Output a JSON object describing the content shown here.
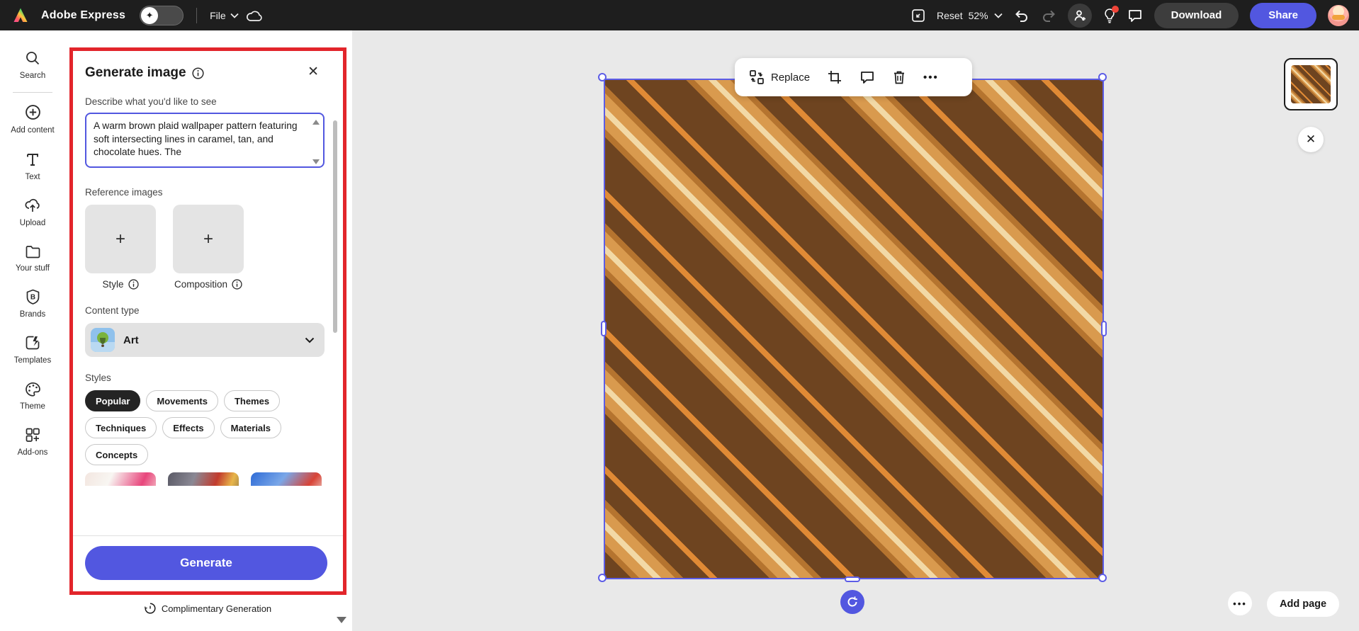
{
  "app": {
    "name": "Adobe Express"
  },
  "topbar": {
    "file_label": "File",
    "reset_label": "Reset",
    "zoom_value": "52%",
    "download_label": "Download",
    "share_label": "Share"
  },
  "sidebar": {
    "items": [
      {
        "label": "Search",
        "icon": "search-icon"
      },
      {
        "label": "Add content",
        "icon": "add-content-icon"
      },
      {
        "label": "Text",
        "icon": "text-icon"
      },
      {
        "label": "Upload",
        "icon": "upload-icon"
      },
      {
        "label": "Your stuff",
        "icon": "folder-icon"
      },
      {
        "label": "Brands",
        "icon": "brands-icon"
      },
      {
        "label": "Templates",
        "icon": "templates-icon"
      },
      {
        "label": "Theme",
        "icon": "theme-palette-icon"
      },
      {
        "label": "Add-ons",
        "icon": "add-ons-icon"
      }
    ]
  },
  "panel": {
    "title": "Generate image",
    "prompt": {
      "label": "Describe what you'd like to see",
      "value": "A warm brown plaid wallpaper pattern featuring soft intersecting lines in caramel, tan, and chocolate hues. The"
    },
    "reference": {
      "label": "Reference images",
      "style_label": "Style",
      "composition_label": "Composition"
    },
    "content_type": {
      "label": "Content type",
      "value": "Art"
    },
    "styles": {
      "label": "Styles",
      "chips": [
        {
          "label": "Popular",
          "selected": true
        },
        {
          "label": "Movements",
          "selected": false
        },
        {
          "label": "Themes",
          "selected": false
        },
        {
          "label": "Techniques",
          "selected": false
        },
        {
          "label": "Effects",
          "selected": false
        },
        {
          "label": "Materials",
          "selected": false
        },
        {
          "label": "Concepts",
          "selected": false
        }
      ]
    },
    "generate_label": "Generate",
    "complimentary_label": "Complimentary Generation"
  },
  "canvas": {
    "toolbar": {
      "replace_label": "Replace"
    },
    "add_page_label": "Add page"
  },
  "glyphs": {
    "close": "✕",
    "plus": "+",
    "more": "•••",
    "sparkle": "✦"
  },
  "colors": {
    "accent": "#5257e0",
    "annotation_red": "#e2252b",
    "selection_blue": "#5c5ce6",
    "topbar_bg": "#1e1e1e",
    "canvas_bg": "#e9e9e9"
  }
}
